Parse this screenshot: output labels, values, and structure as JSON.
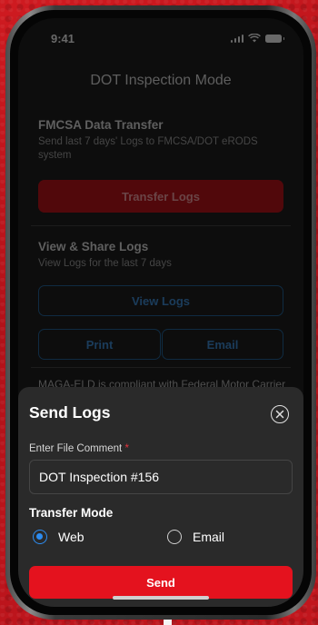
{
  "status_bar": {
    "time": "9:41"
  },
  "header": {
    "title": "DOT Inspection Mode"
  },
  "fmcsa": {
    "title": "FMCSA Data Transfer",
    "description": "Send last 7 days' Logs to FMCSA/DOT eRODS system",
    "button_label": "Transfer Logs"
  },
  "view_share": {
    "title": "View & Share Logs",
    "description": "View Logs for the last 7 days",
    "view_label": "View Logs",
    "print_label": "Print",
    "email_label": "Email"
  },
  "notice": {
    "text": "MAGA-ELD is compliant with Federal Motor Carrier"
  },
  "sheet": {
    "title": "Send Logs",
    "comment_label": "Enter File Comment",
    "required_mark": "*",
    "comment_value": "DOT Inspection #156",
    "transfer_mode_label": "Transfer Mode",
    "options": [
      {
        "label": "Web",
        "selected": true
      },
      {
        "label": "Email",
        "selected": false
      }
    ],
    "send_label": "Send"
  },
  "colors": {
    "accent": "#e4121e",
    "radio_selected": "#2d8cf0",
    "background_red": "#b8141b"
  }
}
